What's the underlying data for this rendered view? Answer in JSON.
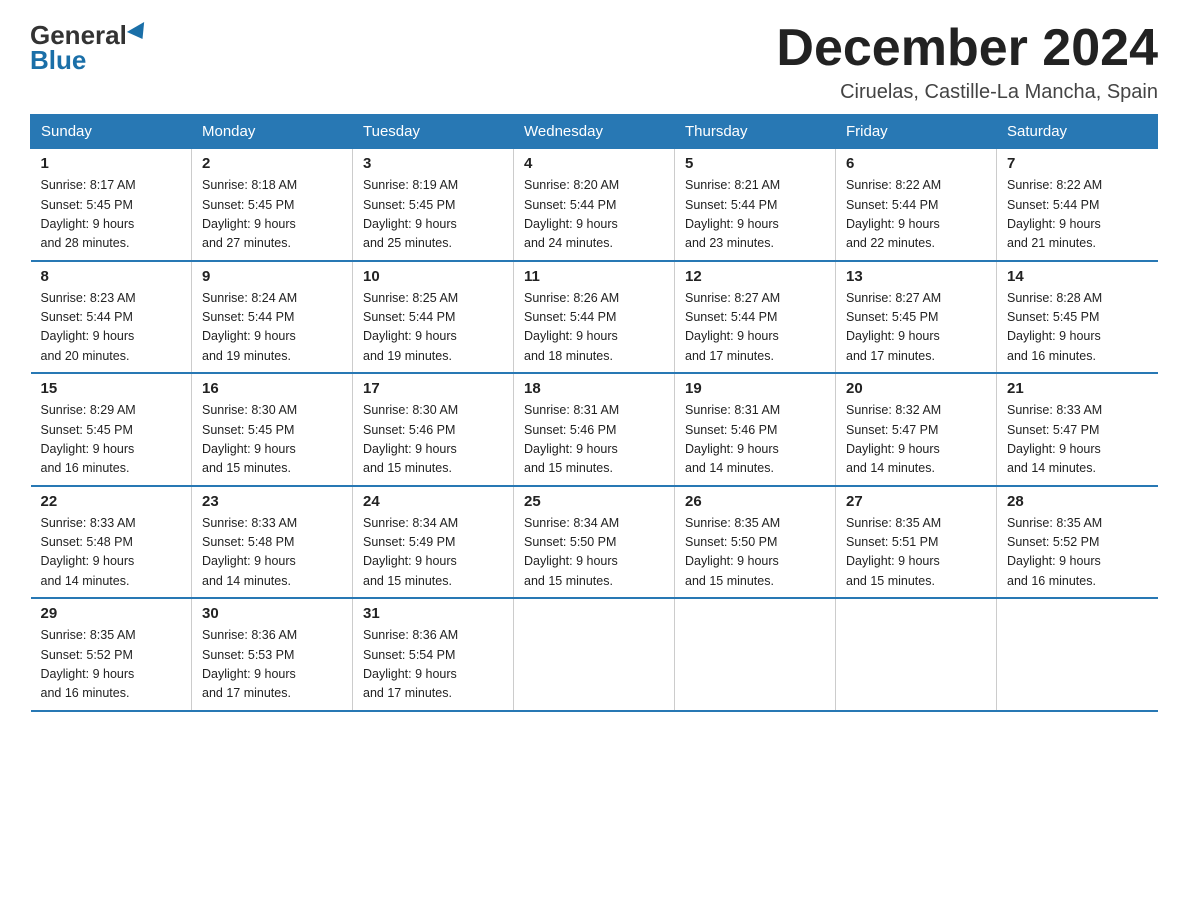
{
  "header": {
    "logo_general": "General",
    "logo_blue": "Blue",
    "month_title": "December 2024",
    "location": "Ciruelas, Castille-La Mancha, Spain"
  },
  "weekdays": [
    "Sunday",
    "Monday",
    "Tuesday",
    "Wednesday",
    "Thursday",
    "Friday",
    "Saturday"
  ],
  "weeks": [
    [
      {
        "day": "1",
        "sunrise": "8:17 AM",
        "sunset": "5:45 PM",
        "daylight": "9 hours and 28 minutes."
      },
      {
        "day": "2",
        "sunrise": "8:18 AM",
        "sunset": "5:45 PM",
        "daylight": "9 hours and 27 minutes."
      },
      {
        "day": "3",
        "sunrise": "8:19 AM",
        "sunset": "5:45 PM",
        "daylight": "9 hours and 25 minutes."
      },
      {
        "day": "4",
        "sunrise": "8:20 AM",
        "sunset": "5:44 PM",
        "daylight": "9 hours and 24 minutes."
      },
      {
        "day": "5",
        "sunrise": "8:21 AM",
        "sunset": "5:44 PM",
        "daylight": "9 hours and 23 minutes."
      },
      {
        "day": "6",
        "sunrise": "8:22 AM",
        "sunset": "5:44 PM",
        "daylight": "9 hours and 22 minutes."
      },
      {
        "day": "7",
        "sunrise": "8:22 AM",
        "sunset": "5:44 PM",
        "daylight": "9 hours and 21 minutes."
      }
    ],
    [
      {
        "day": "8",
        "sunrise": "8:23 AM",
        "sunset": "5:44 PM",
        "daylight": "9 hours and 20 minutes."
      },
      {
        "day": "9",
        "sunrise": "8:24 AM",
        "sunset": "5:44 PM",
        "daylight": "9 hours and 19 minutes."
      },
      {
        "day": "10",
        "sunrise": "8:25 AM",
        "sunset": "5:44 PM",
        "daylight": "9 hours and 19 minutes."
      },
      {
        "day": "11",
        "sunrise": "8:26 AM",
        "sunset": "5:44 PM",
        "daylight": "9 hours and 18 minutes."
      },
      {
        "day": "12",
        "sunrise": "8:27 AM",
        "sunset": "5:44 PM",
        "daylight": "9 hours and 17 minutes."
      },
      {
        "day": "13",
        "sunrise": "8:27 AM",
        "sunset": "5:45 PM",
        "daylight": "9 hours and 17 minutes."
      },
      {
        "day": "14",
        "sunrise": "8:28 AM",
        "sunset": "5:45 PM",
        "daylight": "9 hours and 16 minutes."
      }
    ],
    [
      {
        "day": "15",
        "sunrise": "8:29 AM",
        "sunset": "5:45 PM",
        "daylight": "9 hours and 16 minutes."
      },
      {
        "day": "16",
        "sunrise": "8:30 AM",
        "sunset": "5:45 PM",
        "daylight": "9 hours and 15 minutes."
      },
      {
        "day": "17",
        "sunrise": "8:30 AM",
        "sunset": "5:46 PM",
        "daylight": "9 hours and 15 minutes."
      },
      {
        "day": "18",
        "sunrise": "8:31 AM",
        "sunset": "5:46 PM",
        "daylight": "9 hours and 15 minutes."
      },
      {
        "day": "19",
        "sunrise": "8:31 AM",
        "sunset": "5:46 PM",
        "daylight": "9 hours and 14 minutes."
      },
      {
        "day": "20",
        "sunrise": "8:32 AM",
        "sunset": "5:47 PM",
        "daylight": "9 hours and 14 minutes."
      },
      {
        "day": "21",
        "sunrise": "8:33 AM",
        "sunset": "5:47 PM",
        "daylight": "9 hours and 14 minutes."
      }
    ],
    [
      {
        "day": "22",
        "sunrise": "8:33 AM",
        "sunset": "5:48 PM",
        "daylight": "9 hours and 14 minutes."
      },
      {
        "day": "23",
        "sunrise": "8:33 AM",
        "sunset": "5:48 PM",
        "daylight": "9 hours and 14 minutes."
      },
      {
        "day": "24",
        "sunrise": "8:34 AM",
        "sunset": "5:49 PM",
        "daylight": "9 hours and 15 minutes."
      },
      {
        "day": "25",
        "sunrise": "8:34 AM",
        "sunset": "5:50 PM",
        "daylight": "9 hours and 15 minutes."
      },
      {
        "day": "26",
        "sunrise": "8:35 AM",
        "sunset": "5:50 PM",
        "daylight": "9 hours and 15 minutes."
      },
      {
        "day": "27",
        "sunrise": "8:35 AM",
        "sunset": "5:51 PM",
        "daylight": "9 hours and 15 minutes."
      },
      {
        "day": "28",
        "sunrise": "8:35 AM",
        "sunset": "5:52 PM",
        "daylight": "9 hours and 16 minutes."
      }
    ],
    [
      {
        "day": "29",
        "sunrise": "8:35 AM",
        "sunset": "5:52 PM",
        "daylight": "9 hours and 16 minutes."
      },
      {
        "day": "30",
        "sunrise": "8:36 AM",
        "sunset": "5:53 PM",
        "daylight": "9 hours and 17 minutes."
      },
      {
        "day": "31",
        "sunrise": "8:36 AM",
        "sunset": "5:54 PM",
        "daylight": "9 hours and 17 minutes."
      },
      null,
      null,
      null,
      null
    ]
  ],
  "labels": {
    "sunrise": "Sunrise:",
    "sunset": "Sunset:",
    "daylight": "Daylight:"
  }
}
